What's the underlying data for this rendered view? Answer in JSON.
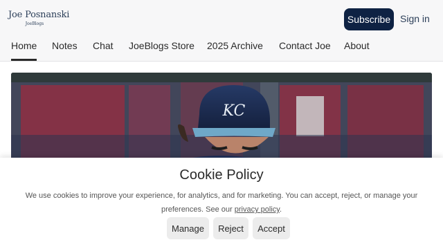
{
  "header": {
    "logo_title": "Joe Posnanski",
    "logo_subtitle": "JoeBlogs",
    "subscribe_label": "Subscribe",
    "signin_label": "Sign in"
  },
  "nav": {
    "tabs": [
      {
        "label": "Home",
        "active": true
      },
      {
        "label": "Notes"
      },
      {
        "label": "Chat"
      },
      {
        "label": "JoeBlogs Store"
      },
      {
        "label": "2025 Archive"
      },
      {
        "label": "Contact Joe"
      },
      {
        "label": "About"
      }
    ]
  },
  "hero": {
    "cap_letters": "KC"
  },
  "cookie": {
    "title": "Cookie Policy",
    "text_before_link": "We use cookies to improve your experience, for analytics, and for marketing. You can accept, reject, or manage your preferences. See our ",
    "link_label": "privacy policy",
    "text_after_link": ".",
    "buttons": {
      "manage": "Manage",
      "reject": "Reject",
      "accept": "Accept"
    }
  },
  "colors": {
    "subscribe_bg": "#0e2243",
    "brand_text": "#2b3e58",
    "header_bg": "#f7f7f8",
    "cookie_button_bg": "#ececec"
  }
}
